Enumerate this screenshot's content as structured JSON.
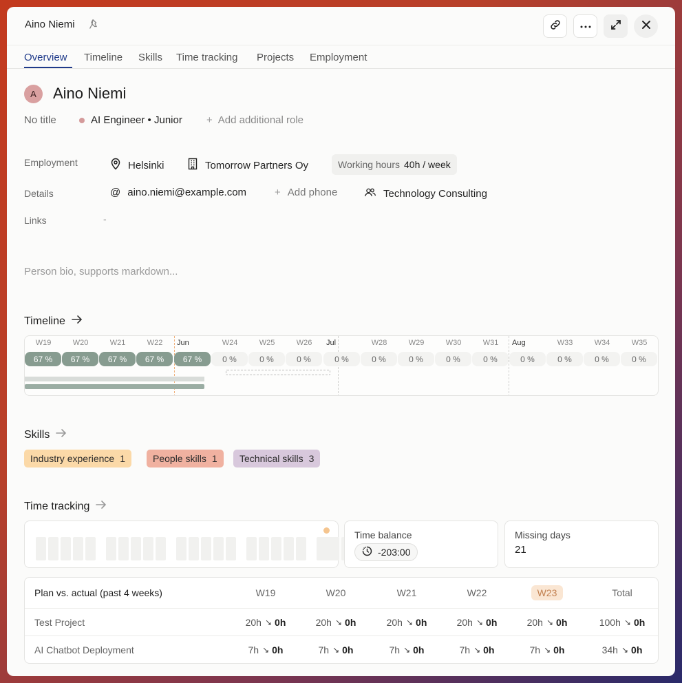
{
  "header": {
    "title": "Aino Niemi"
  },
  "tabs": [
    {
      "label": "Overview",
      "active": true
    },
    {
      "label": "Timeline"
    },
    {
      "label": "Skills"
    },
    {
      "label": "Time tracking"
    },
    {
      "label": "Projects"
    },
    {
      "label": "Employment"
    }
  ],
  "person": {
    "initial": "A",
    "name": "Aino Niemi",
    "title": "No title",
    "role": "AI Engineer • Junior",
    "add_role": "Add additional role"
  },
  "employment": {
    "label": "Employment",
    "location": "Helsinki",
    "company": "Tomorrow Partners Oy",
    "hours_label": "Working hours",
    "hours_value": "40h / week"
  },
  "details": {
    "label": "Details",
    "email": "aino.niemi@example.com",
    "add_phone": "Add phone",
    "team": "Technology Consulting"
  },
  "links": {
    "label": "Links",
    "value": "-"
  },
  "bio_placeholder": "Person bio, supports markdown...",
  "timeline": {
    "title": "Timeline",
    "weeks": [
      "W19",
      "W20",
      "W21",
      "W22",
      "Jun",
      "W24",
      "W25",
      "W26",
      "Jul",
      "W28",
      "W29",
      "W30",
      "W31",
      "Aug",
      "W33",
      "W34",
      "W35"
    ],
    "allocations": [
      "67 %",
      "67 %",
      "67 %",
      "67 %",
      "67 %",
      "0 %",
      "0 %",
      "0 %",
      "0 %",
      "0 %",
      "0 %",
      "0 %",
      "0 %",
      "0 %",
      "0 %",
      "0 %",
      "0 %"
    ]
  },
  "skills": {
    "title": "Skills",
    "items": [
      {
        "label": "Industry experience",
        "count": "1",
        "color": "#fbd9a8"
      },
      {
        "label": "People skills",
        "count": "1",
        "color": "#f0b1a0"
      },
      {
        "label": "Technical skills",
        "count": "3",
        "color": "#d8c8dc"
      }
    ]
  },
  "time_tracking": {
    "title": "Time tracking",
    "balance_label": "Time balance",
    "balance_value": "-203:00",
    "missing_label": "Missing days",
    "missing_value": "21",
    "plan_table": {
      "title": "Plan vs. actual (past 4 weeks)",
      "columns": [
        "W19",
        "W20",
        "W21",
        "W22",
        "W23",
        "Total"
      ],
      "rows": [
        {
          "name": "Test Project",
          "plan": [
            "20h",
            "20h",
            "20h",
            "20h",
            "20h",
            "100h"
          ],
          "actual": [
            "0h",
            "0h",
            "0h",
            "0h",
            "0h",
            "0h"
          ]
        },
        {
          "name": "AI Chatbot Deployment",
          "plan": [
            "7h",
            "7h",
            "7h",
            "7h",
            "7h",
            "34h"
          ],
          "actual": [
            "0h",
            "0h",
            "0h",
            "0h",
            "0h",
            "0h"
          ]
        }
      ]
    }
  },
  "colors": {
    "accent": "#1f3a8a",
    "allocation_fill": "#879c90",
    "current_week": "#fae6d3"
  }
}
